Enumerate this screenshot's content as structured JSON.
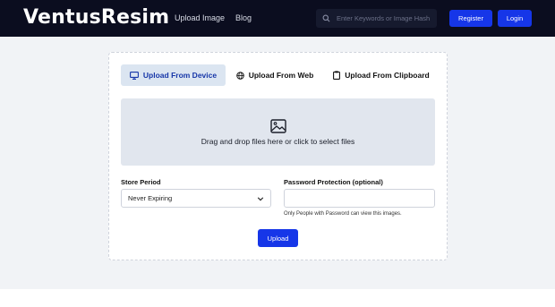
{
  "navbar": {
    "brand": "VentusResim",
    "links": [
      {
        "label": "Upload Image"
      },
      {
        "label": "Blog"
      }
    ],
    "search": {
      "placeholder": "Enter Keywords or Image Hash",
      "value": ""
    },
    "register_label": "Register",
    "login_label": "Login"
  },
  "upload_card": {
    "tabs": [
      {
        "label": "Upload From Device",
        "active": true,
        "icon": "monitor-icon"
      },
      {
        "label": "Upload From Web",
        "active": false,
        "icon": "globe-icon"
      },
      {
        "label": "Upload From Clipboard",
        "active": false,
        "icon": "clipboard-icon"
      }
    ],
    "dropzone": {
      "text": "Drag and drop files here or click to select files",
      "icon": "image-icon"
    },
    "store_period": {
      "label": "Store Period",
      "value": "Never Expiring"
    },
    "password": {
      "label": "Password Protection (optional)",
      "value": "",
      "helper": "Only People with Password can view this images."
    },
    "upload_label": "Upload"
  },
  "colors": {
    "navbar_bg": "#0b0d1f",
    "accent": "#1636e8",
    "active_tab_bg": "#dbe5f1",
    "dropzone_bg": "#e1e6ee"
  }
}
